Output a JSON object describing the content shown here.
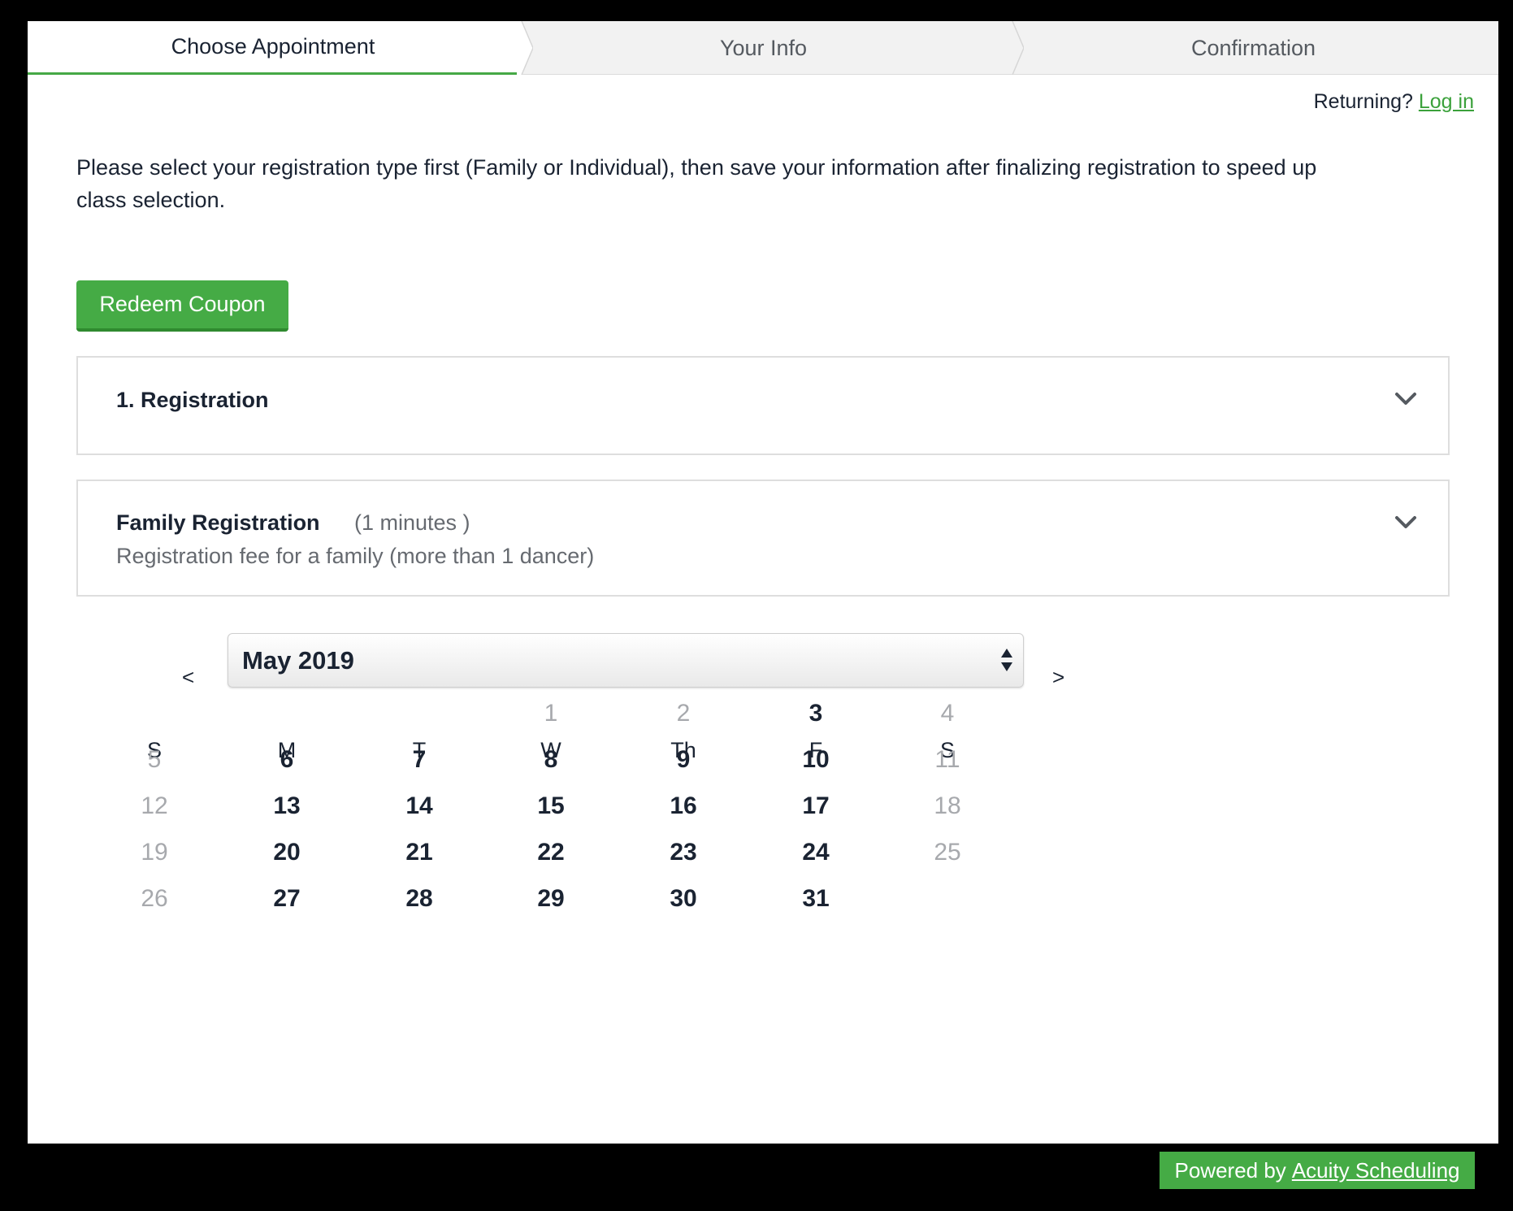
{
  "steps": [
    {
      "label": "Choose Appointment",
      "active": true
    },
    {
      "label": "Your Info",
      "active": false
    },
    {
      "label": "Confirmation",
      "active": false
    }
  ],
  "returning": {
    "text": "Returning?",
    "link": "Log in"
  },
  "intro": "Please select your registration type first (Family or Individual), then save your information after finalizing registration to speed up class selection.",
  "coupon_button": "Redeem Coupon",
  "category": {
    "title": "1. Registration",
    "icon": "chevron-down-icon"
  },
  "appointment": {
    "title": "Family Registration",
    "duration": "(1 minutes )",
    "description": "Registration fee for a family (more than 1 dancer)",
    "icon": "chevron-down-icon"
  },
  "calendar": {
    "prev": "<",
    "next": ">",
    "month": "May 2019",
    "weekdays": [
      "S",
      "M",
      "T",
      "W",
      "Th",
      "F",
      "S"
    ],
    "first_weekday": 3,
    "days": [
      {
        "d": "1",
        "available": false
      },
      {
        "d": "2",
        "available": false
      },
      {
        "d": "3",
        "available": true
      },
      {
        "d": "4",
        "available": false
      },
      {
        "d": "5",
        "available": false
      },
      {
        "d": "6",
        "available": true
      },
      {
        "d": "7",
        "available": true
      },
      {
        "d": "8",
        "available": true
      },
      {
        "d": "9",
        "available": true
      },
      {
        "d": "10",
        "available": true
      },
      {
        "d": "11",
        "available": false
      },
      {
        "d": "12",
        "available": false
      },
      {
        "d": "13",
        "available": true
      },
      {
        "d": "14",
        "available": true
      },
      {
        "d": "15",
        "available": true
      },
      {
        "d": "16",
        "available": true
      },
      {
        "d": "17",
        "available": true
      },
      {
        "d": "18",
        "available": false
      },
      {
        "d": "19",
        "available": false
      },
      {
        "d": "20",
        "available": true
      },
      {
        "d": "21",
        "available": true
      },
      {
        "d": "22",
        "available": true
      },
      {
        "d": "23",
        "available": true
      },
      {
        "d": "24",
        "available": true
      },
      {
        "d": "25",
        "available": false
      },
      {
        "d": "26",
        "available": false
      },
      {
        "d": "27",
        "available": true
      },
      {
        "d": "28",
        "available": true
      },
      {
        "d": "29",
        "available": true
      },
      {
        "d": "30",
        "available": true
      },
      {
        "d": "31",
        "available": true
      }
    ]
  },
  "powered": {
    "prefix": "Powered by",
    "link": "Acuity Scheduling"
  },
  "colors": {
    "accent": "#45ab45",
    "text": "#1a2332",
    "muted": "#a7a9ad"
  }
}
